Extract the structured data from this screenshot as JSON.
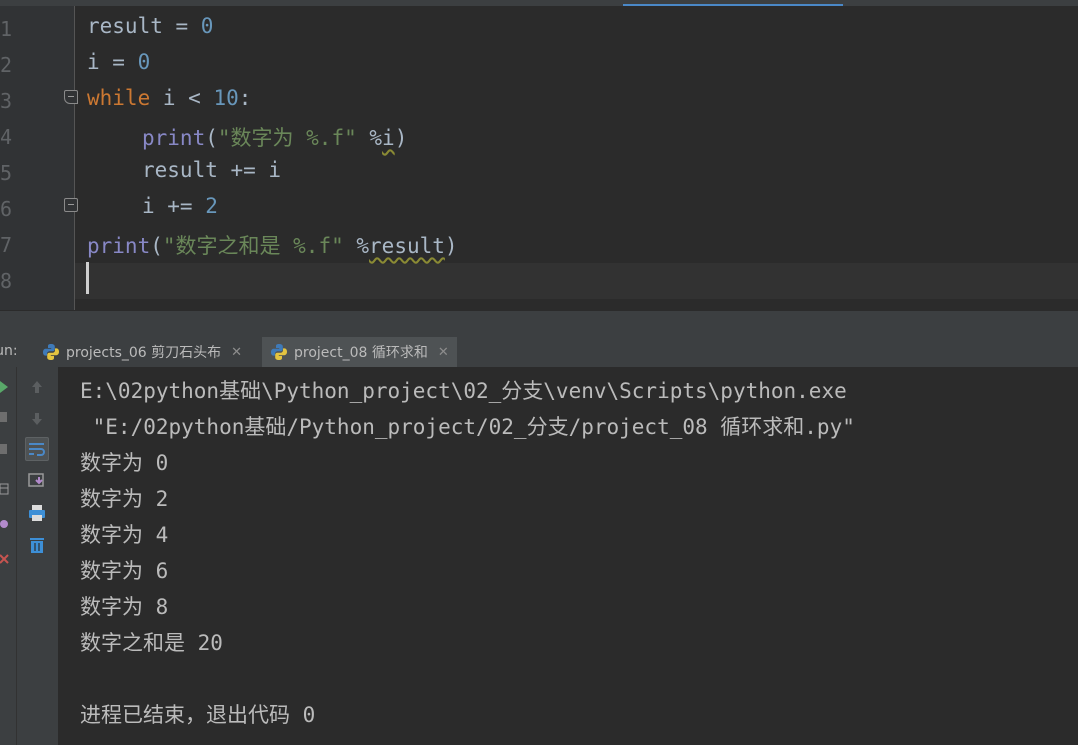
{
  "editor": {
    "line_numbers": [
      "1",
      "2",
      "3",
      "4",
      "5",
      "6",
      "7",
      "8"
    ],
    "code": {
      "l1_var": "result",
      "l1_op": " = ",
      "l1_num": "0",
      "l2_var": "i",
      "l2_op": " = ",
      "l2_num": "0",
      "l3_kw": "while",
      "l3_mid": " i < ",
      "l3_num": "10",
      "l3_end": ":",
      "l4_fn": "print",
      "l4_open": "(",
      "l4_str": "\"数字为 %.f\"",
      "l4_sp": " %",
      "l4_arg": "i",
      "l4_close": ")",
      "l5_text": "result += i",
      "l6_mid": "i += ",
      "l6_num": "2",
      "l7_fn": "print",
      "l7_open": "(",
      "l7_str": "\"数字之和是 %.f\"",
      "l7_sp": " %",
      "l7_arg": "result",
      "l7_close": ")"
    }
  },
  "run_panel": {
    "label": "Run:",
    "tabs": [
      {
        "label": "projects_06 剪刀石头布"
      },
      {
        "label": "project_08 循环求和"
      }
    ]
  },
  "console": {
    "lines": [
      "E:\\02python基础\\Python_project\\02_分支\\venv\\Scripts\\python.exe",
      " \"E:/02python基础/Python_project/02_分支/project_08 循环求和.py\"",
      "数字为 0",
      "数字为 2",
      "数字为 4",
      "数字为 6",
      "数字为 8",
      "数字之和是 20",
      "",
      "进程已结束，退出代码 0"
    ]
  },
  "colors": {
    "keyword": "#cc7832",
    "number": "#6897bb",
    "string": "#6a8759",
    "builtin": "#8888c6",
    "text": "#a9b7c6",
    "background": "#2b2b2b"
  },
  "icons": [
    "python-file-icon",
    "close-icon",
    "rerun-icon",
    "stop-icon",
    "up-arrow-icon",
    "down-arrow-icon",
    "soft-wrap-icon",
    "scroll-to-end-icon",
    "print-icon",
    "trash-icon"
  ]
}
